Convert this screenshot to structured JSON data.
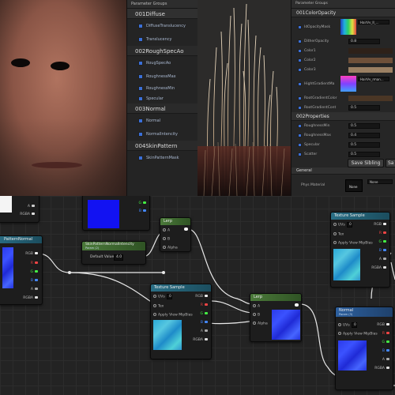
{
  "left_panel": {
    "header": "Parameter Groups",
    "groups": [
      {
        "title": "001Diffuse",
        "items": [
          "DiffuseTranslucency",
          "Translucency"
        ]
      },
      {
        "title": "002RoughSpecAo",
        "items": [
          "RougSpecAo",
          "RoughnessMax",
          "RoughnessMin",
          "Specular"
        ]
      },
      {
        "title": "003Normal",
        "items": [
          "Normal",
          "NormalIntencity"
        ]
      },
      {
        "title": "004SkinPattern",
        "items": [
          "SkinPatternMask"
        ]
      }
    ]
  },
  "right_panel": {
    "header": "Parameter Groups",
    "group1": "001ColorOpacity",
    "rows_a": [
      {
        "label": "IdOpacityMask",
        "dropdown": "HairVv_II_..."
      },
      {
        "label": "DitherOpacity",
        "value": "0.8"
      },
      {
        "label": "Color1",
        "color": "#2e2119"
      },
      {
        "label": "Color2",
        "color": "#6e5039"
      },
      {
        "label": "Color3",
        "color": "#9b8063"
      },
      {
        "label": "HightGradientMa",
        "dropdown": "HairVv_rman..."
      },
      {
        "label": "RootGradientColor",
        "color": "#4a3625"
      },
      {
        "label": "RootGradientCont",
        "value": "0.5"
      }
    ],
    "group2": "002Properties",
    "rows_b": [
      {
        "label": "RoughnessMin",
        "value": "0.5"
      },
      {
        "label": "RoughnessMax",
        "value": "0.4"
      },
      {
        "label": "Specular",
        "value": "0.5"
      },
      {
        "label": "Scatter",
        "value": "0.5"
      }
    ],
    "save_sibling": "Save Sibling",
    "save_sa": "Sa",
    "general": "General",
    "phys_label": "Phys Material",
    "phys_thumb": "None",
    "phys_value": "None"
  },
  "graph": {
    "partial_node": {
      "pins": [
        "A",
        "RGBA"
      ]
    },
    "partial_node2": {
      "title": "PatternNormal",
      "pins": [
        "RGB",
        "R",
        "G",
        "B",
        "A",
        "RGBA"
      ]
    },
    "skin_param": {
      "title": "SkinPatternNormalIntencity",
      "subtitle": "Param (2)",
      "label": "Default Value",
      "value": "4.0"
    },
    "lerp1": {
      "title": "Lerp",
      "pins": [
        "A",
        "B",
        "Alpha"
      ]
    },
    "tex_sample_center": {
      "title": "Texture Sample",
      "uvs": "UVs",
      "uvs_val": "0",
      "tex": "Tex",
      "apply": "Apply View MipBias",
      "outs": [
        "RGB",
        "R",
        "G",
        "B",
        "A",
        "RGBA"
      ]
    },
    "lerp2": {
      "title": "Lerp",
      "pins": [
        "A",
        "B",
        "Alpha"
      ]
    },
    "tex_sample_right": {
      "title": "Texture Sample",
      "uvs": "UVs",
      "uvs_val": "0",
      "tex": "Tex",
      "apply": "Apply View MipBias",
      "outs": [
        "RGB",
        "R",
        "G",
        "B",
        "A",
        "RGBA"
      ]
    },
    "normal_node": {
      "title": "Normal",
      "subtitle": "Param (3)",
      "uvs": "UVs",
      "uvs_val": "0",
      "apply": "Apply View MipBias",
      "outs": [
        "RGB",
        "R",
        "G",
        "B",
        "A",
        "RGBA"
      ]
    },
    "top_node_outs": [
      "G",
      "B"
    ]
  },
  "colors": {
    "accent": "#3a6fd8",
    "texture_blue": "#2b3bea"
  }
}
